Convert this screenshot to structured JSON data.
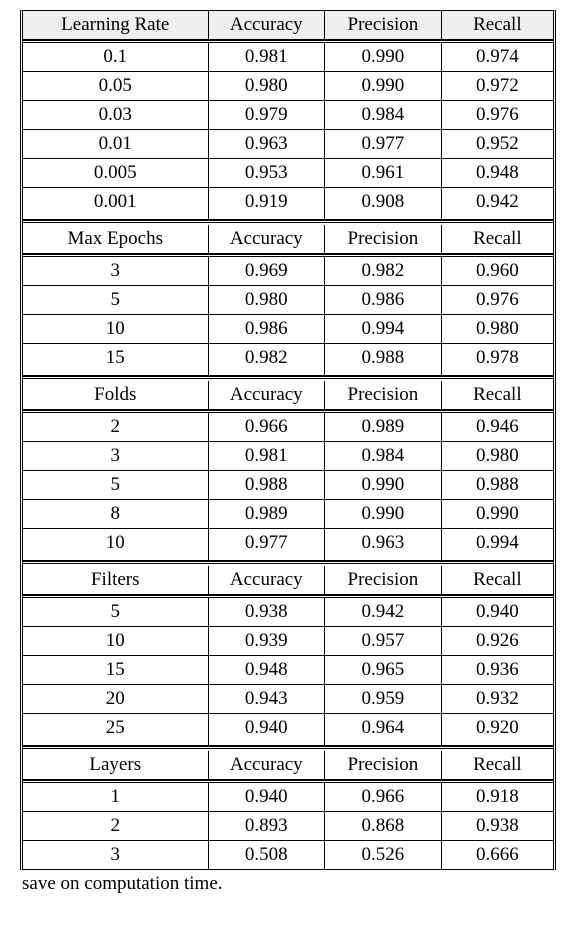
{
  "caption_fragment": "save on computation time.",
  "sections": [
    {
      "header": {
        "param": "Learning Rate",
        "accuracy": "Accuracy",
        "precision": "Precision",
        "recall": "Recall"
      },
      "rows": [
        {
          "param": "0.1",
          "accuracy": "0.981",
          "precision": "0.990",
          "recall": "0.974"
        },
        {
          "param": "0.05",
          "accuracy": "0.980",
          "precision": "0.990",
          "recall": "0.972"
        },
        {
          "param": "0.03",
          "accuracy": "0.979",
          "precision": "0.984",
          "recall": "0.976"
        },
        {
          "param": "0.01",
          "accuracy": "0.963",
          "precision": "0.977",
          "recall": "0.952"
        },
        {
          "param": "0.005",
          "accuracy": "0.953",
          "precision": "0.961",
          "recall": "0.948"
        },
        {
          "param": "0.001",
          "accuracy": "0.919",
          "precision": "0.908",
          "recall": "0.942"
        }
      ]
    },
    {
      "header": {
        "param": "Max Epochs",
        "accuracy": "Accuracy",
        "precision": "Precision",
        "recall": "Recall"
      },
      "rows": [
        {
          "param": "3",
          "accuracy": "0.969",
          "precision": "0.982",
          "recall": "0.960"
        },
        {
          "param": "5",
          "accuracy": "0.980",
          "precision": "0.986",
          "recall": "0.976"
        },
        {
          "param": "10",
          "accuracy": "0.986",
          "precision": "0.994",
          "recall": "0.980"
        },
        {
          "param": "15",
          "accuracy": "0.982",
          "precision": "0.988",
          "recall": "0.978"
        }
      ]
    },
    {
      "header": {
        "param": "Folds",
        "accuracy": "Accuracy",
        "precision": "Precision",
        "recall": "Recall"
      },
      "rows": [
        {
          "param": "2",
          "accuracy": "0.966",
          "precision": "0.989",
          "recall": "0.946"
        },
        {
          "param": "3",
          "accuracy": "0.981",
          "precision": "0.984",
          "recall": "0.980"
        },
        {
          "param": "5",
          "accuracy": "0.988",
          "precision": "0.990",
          "recall": "0.988"
        },
        {
          "param": "8",
          "accuracy": "0.989",
          "precision": "0.990",
          "recall": "0.990"
        },
        {
          "param": "10",
          "accuracy": "0.977",
          "precision": "0.963",
          "recall": "0.994"
        }
      ]
    },
    {
      "header": {
        "param": "Filters",
        "accuracy": "Accuracy",
        "precision": "Precision",
        "recall": "Recall"
      },
      "rows": [
        {
          "param": "5",
          "accuracy": "0.938",
          "precision": "0.942",
          "recall": "0.940"
        },
        {
          "param": "10",
          "accuracy": "0.939",
          "precision": "0.957",
          "recall": "0.926"
        },
        {
          "param": "15",
          "accuracy": "0.948",
          "precision": "0.965",
          "recall": "0.936"
        },
        {
          "param": "20",
          "accuracy": "0.943",
          "precision": "0.959",
          "recall": "0.932"
        },
        {
          "param": "25",
          "accuracy": "0.940",
          "precision": "0.964",
          "recall": "0.920"
        }
      ]
    },
    {
      "header": {
        "param": "Layers",
        "accuracy": "Accuracy",
        "precision": "Precision",
        "recall": "Recall"
      },
      "rows": [
        {
          "param": "1",
          "accuracy": "0.940",
          "precision": "0.966",
          "recall": "0.918"
        },
        {
          "param": "2",
          "accuracy": "0.893",
          "precision": "0.868",
          "recall": "0.938"
        },
        {
          "param": "3",
          "accuracy": "0.508",
          "precision": "0.526",
          "recall": "0.666"
        }
      ]
    }
  ]
}
